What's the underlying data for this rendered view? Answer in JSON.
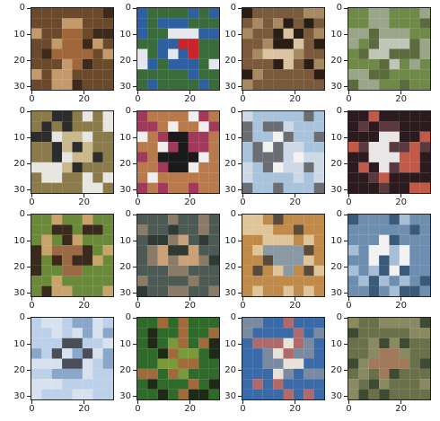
{
  "figure": {
    "rows": 4,
    "cols": 4,
    "image_grid_size": 32,
    "axes": {
      "y_ticks": [
        "0",
        "10",
        "20",
        "30"
      ],
      "x_ticks": [
        "0",
        "20"
      ]
    },
    "tiles": [
      {
        "subject": "cat on patterned blanket",
        "palette": [
          "#6b4a2c",
          "#a0683a",
          "#3d2a1b",
          "#c49a6c"
        ]
      },
      {
        "subject": "red boat at harbor with trees",
        "palette": [
          "#3a6b3a",
          "#c8242a",
          "#e4e8ee",
          "#2e5fa0"
        ]
      },
      {
        "subject": "close-up of small fluffy dog",
        "palette": [
          "#7a5a3a",
          "#d9c3a0",
          "#2a1e14",
          "#a78a62"
        ]
      },
      {
        "subject": "grassy field landscape",
        "palette": [
          "#6f8a48",
          "#bfc6b8",
          "#5b6b3d",
          "#9aa58a"
        ]
      },
      {
        "subject": "small bird on ground",
        "palette": [
          "#8b7a4a",
          "#c9b98c",
          "#2c2c2c",
          "#e8e6e0"
        ]
      },
      {
        "subject": "black and white dog",
        "palette": [
          "#b87a4a",
          "#1a1a1a",
          "#f0eeee",
          "#a13a5a"
        ]
      },
      {
        "subject": "white truck",
        "palette": [
          "#a9c3dc",
          "#f2f2f0",
          "#6a6e72",
          "#cdd9e6"
        ]
      },
      {
        "subject": "white airplane on dark background",
        "palette": [
          "#2b1a1e",
          "#e8e6e6",
          "#5a3a3e",
          "#c25a4a"
        ]
      },
      {
        "subject": "frog close-up",
        "palette": [
          "#6a8a3a",
          "#9a6a44",
          "#3a2a1c",
          "#c8a36a"
        ]
      },
      {
        "subject": "cat in cage",
        "palette": [
          "#4d5a54",
          "#c9a27a",
          "#2f3a34",
          "#8a7a66"
        ]
      },
      {
        "subject": "orange cat sitting",
        "palette": [
          "#c08a4a",
          "#8a9aa4",
          "#5a4a3a",
          "#e0c49a"
        ]
      },
      {
        "subject": "white ship on water",
        "palette": [
          "#6e8eb0",
          "#f2f2f2",
          "#3a5a7a",
          "#a7bfd6"
        ]
      },
      {
        "subject": "airplane on runway",
        "palette": [
          "#bcd0ea",
          "#4a4e58",
          "#8aa6c8",
          "#d8e2ee"
        ]
      },
      {
        "subject": "small bird on branch",
        "palette": [
          "#2f6a2a",
          "#7a9a3a",
          "#a06a3a",
          "#1c2a16"
        ]
      },
      {
        "subject": "ship hull and water",
        "palette": [
          "#3a6aa8",
          "#e9e2da",
          "#b06a6a",
          "#7a8aa0"
        ]
      },
      {
        "subject": "deer in grass",
        "palette": [
          "#6a704a",
          "#a07a5a",
          "#3f4a32",
          "#8a8a62"
        ]
      }
    ]
  }
}
